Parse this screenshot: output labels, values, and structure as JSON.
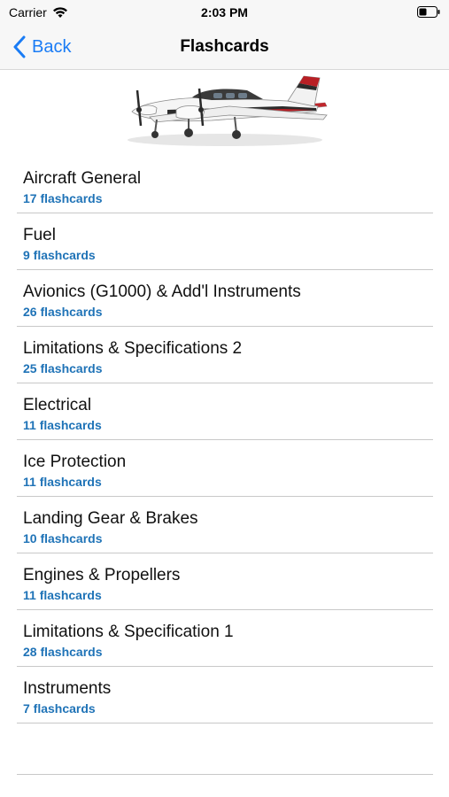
{
  "status_bar": {
    "carrier": "Carrier",
    "time": "2:03 PM",
    "icons": [
      "wifi-icon",
      "battery-icon"
    ]
  },
  "nav": {
    "back_label": "Back",
    "title": "Flashcards",
    "accent_color": "#1a7cf5"
  },
  "hero": {
    "image": "airplane-illustration"
  },
  "decks": [
    {
      "title": "Aircraft General",
      "count": "17 flashcards"
    },
    {
      "title": "Fuel",
      "count": "9 flashcards"
    },
    {
      "title": "Avionics (G1000) & Add'l Instruments",
      "count": "26 flashcards"
    },
    {
      "title": "Limitations & Specifications 2",
      "count": "25 flashcards"
    },
    {
      "title": "Electrical",
      "count": "11 flashcards"
    },
    {
      "title": "Ice Protection",
      "count": "11 flashcards"
    },
    {
      "title": "Landing Gear & Brakes",
      "count": "10 flashcards"
    },
    {
      "title": "Engines & Propellers",
      "count": "11 flashcards"
    },
    {
      "title": "Limitations & Specification 1",
      "count": "28 flashcards"
    },
    {
      "title": "Instruments",
      "count": "7 flashcards"
    }
  ],
  "colors": {
    "count_text": "#1f73b7",
    "divider": "#c8c8c8"
  }
}
